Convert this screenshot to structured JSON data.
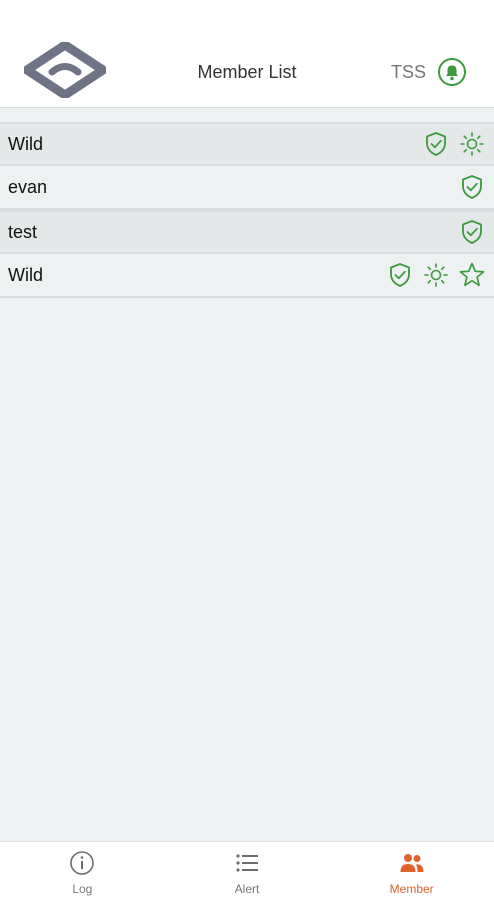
{
  "header": {
    "title": "Member List",
    "org": "TSS",
    "logo_icon": "logo-diamond",
    "bell_icon": "bell-icon"
  },
  "members": [
    {
      "name": "Wild",
      "icons": [
        "shield-check-icon",
        "sun-icon"
      ]
    },
    {
      "name": "evan",
      "icons": [
        "shield-check-icon"
      ]
    },
    {
      "name": "test",
      "icons": [
        "shield-check-icon"
      ]
    },
    {
      "name": "Wild",
      "icons": [
        "shield-check-icon",
        "sun-icon",
        "star-icon"
      ]
    }
  ],
  "tabs": [
    {
      "label": "Log",
      "icon": "info-icon",
      "active": false
    },
    {
      "label": "Alert",
      "icon": "list-icon",
      "active": false
    },
    {
      "label": "Member",
      "icon": "people-icon",
      "active": true
    }
  ],
  "colors": {
    "accent_green": "#3d9a3d",
    "active_tab": "#e0622b",
    "logo_gray": "#6e7385"
  }
}
